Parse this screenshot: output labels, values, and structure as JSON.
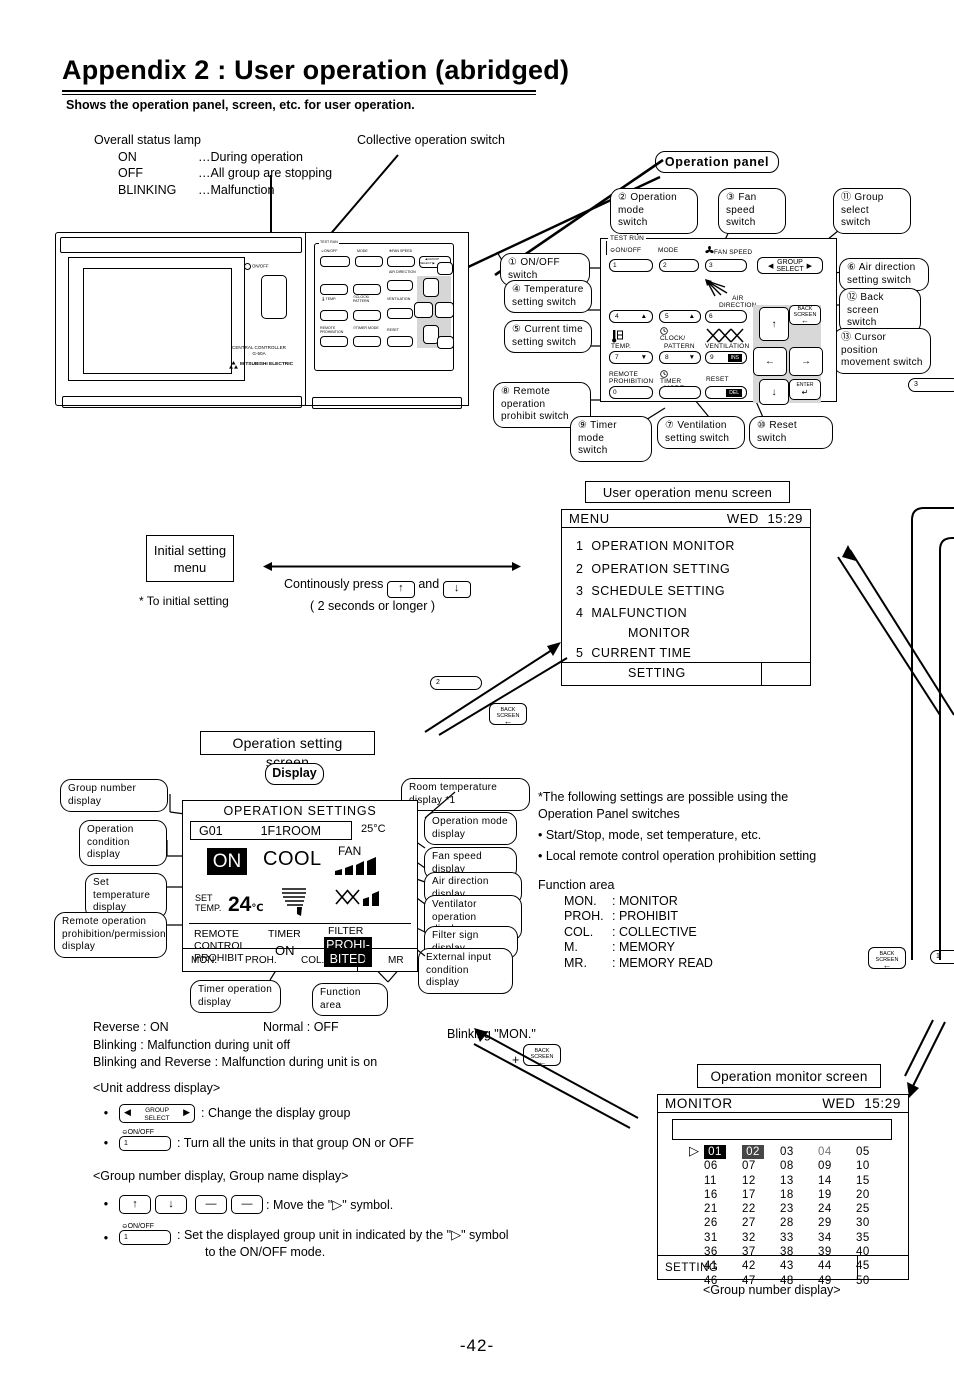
{
  "header": {
    "title": "Appendix 2 : User operation (abridged)",
    "subtitle": "Shows the operation panel, screen, etc. for user operation."
  },
  "status_lamp": {
    "heading": "Overall status lamp",
    "rows": [
      {
        "key": "ON",
        "value": "…During operation"
      },
      {
        "key": "OFF",
        "value": "…All group are stopping"
      },
      {
        "key": "BLINKING",
        "value": "…Malfunction"
      }
    ]
  },
  "collective_switch_label": "Collective operation switch",
  "device": {
    "brand_line1": "CENTRAL  CONTROLLER",
    "brand_line2": "G-50A",
    "logo": "MITSUBISHI ELECTRIC",
    "lamp_label": "ON/OFF"
  },
  "operation_panel": {
    "title": "Operation  panel",
    "callouts": [
      {
        "id": "op-callout-1",
        "text": "① ON/OFF  switch"
      },
      {
        "id": "op-callout-2",
        "text": "② Operation mode\n     switch"
      },
      {
        "id": "op-callout-3",
        "text": "③ Fan  speed\n     switch"
      },
      {
        "id": "op-callout-11",
        "text": "⑪ Group  select\n     switch"
      },
      {
        "id": "op-callout-4",
        "text": "④ Temperature\n     setting switch"
      },
      {
        "id": "op-callout-5",
        "text": "⑤ Current  time\n     setting switch"
      },
      {
        "id": "op-callout-6",
        "text": "⑥ Air  direction\n     setting switch"
      },
      {
        "id": "op-callout-12",
        "text": "⑫ Back  screen\n     switch"
      },
      {
        "id": "op-callout-13",
        "text": "⑬ Cursor  position\n     movement switch"
      },
      {
        "id": "op-callout-8",
        "text": "⑧ Remote operation\n     prohibit switch"
      },
      {
        "id": "op-callout-9",
        "text": "⑨ Timer mode\n     switch"
      },
      {
        "id": "op-callout-7",
        "text": "⑦ Ventilation\n     setting switch"
      },
      {
        "id": "op-callout-10",
        "text": "⑩ Reset  switch"
      }
    ],
    "keys": {
      "test_run": "TEST RUN",
      "on_off": "ON/OFF",
      "mode": "MODE",
      "fan_speed": "FAN SPEED",
      "group_select": "GROUP SELECT",
      "air_direction": "AIR DIRECTION",
      "temp": "TEMP.",
      "clock_pattern": "CLOCK/ PATTERN",
      "ventilation": "VENTILATION",
      "remote_prohibition": "REMOTE PROHIBITION",
      "timer_mode": "TIMER MODE",
      "reset": "RESET",
      "back_screen": "BACK SCREEN",
      "enter": "ENTER",
      "nums": [
        "1",
        "2",
        "3",
        "4",
        "5",
        "6",
        "7",
        "8",
        "9",
        "0"
      ],
      "ins": "INS",
      "del": "DEL"
    }
  },
  "menu_screen": {
    "box_label": "User operation menu screen",
    "title": "MENU",
    "day": "WED",
    "time": "15:29",
    "items": [
      {
        "num": "1",
        "text": "OPERATION  MONITOR",
        "second": ""
      },
      {
        "num": "2",
        "text": "OPERATION  SETTING",
        "second": ""
      },
      {
        "num": "3",
        "text": "SCHEDULE  SETTING",
        "second": ""
      },
      {
        "num": "4",
        "text": "MALFUNCTION",
        "second": "MONITOR"
      },
      {
        "num": "5",
        "text": "CURRENT  TIME",
        "second": "SETTING"
      }
    ]
  },
  "initial_setting": {
    "box_line1": "Initial setting",
    "box_line2": "menu",
    "note": "* To initial setting",
    "press_line1_a": "Continously press",
    "press_line1_and": "and",
    "press_line2": "( 2 seconds or longer )",
    "key_up": "↑",
    "key_down": "↓"
  },
  "operation_setting": {
    "box_label": "Operation setting screen",
    "display_pill": "Display",
    "screen": {
      "title": "OPERATION  SETTINGS",
      "group_no": "G01",
      "group_name": "1F1ROOM",
      "room_temp": "25°C",
      "condition": "ON",
      "mode": "COOL",
      "fan_label": "FAN",
      "set_temp_label1": "SET",
      "set_temp_label2": "TEMP.",
      "set_temp_value": "24",
      "set_temp_unit": "℃",
      "remote_l1": "REMOTE",
      "remote_l2": "CONTROL",
      "remote_l3": "PROHIBIT",
      "timer_label": "TIMER",
      "timer_value": "ON",
      "filter_label": "FILTER",
      "filter_v1": "PROHI-",
      "filter_v2": "BITED",
      "func_items": [
        "MON.",
        "PROH.",
        "COL.",
        "M",
        "MR"
      ]
    },
    "callouts_left": [
      "Group  number  display",
      "Operation\ncondition display",
      "Set  temperature\ndisplay",
      "Remote  operation\nprohibition/permission\ndisplay",
      "Timer  operation\ndisplay",
      "Function  area"
    ],
    "callouts_right": [
      "Room temperature display *1",
      "Operation  mode\ndisplay",
      "Fan  speed  display",
      "Air  direction  display",
      "Ventilator  operation\ndisplay",
      "Filter  sign  display",
      "External  input\ncondition display"
    ]
  },
  "right_notes": {
    "line1": "*The following settings are possible using the",
    "line2": " Operation Panel switches",
    "bullet1": "• Start/Stop, mode, set temperature, etc.",
    "bullet2": "• Local remote control operation prohibition setting",
    "function_area_title": "Function area",
    "function_area": [
      {
        "k": "MON.",
        "v": ": MONITOR"
      },
      {
        "k": "PROH.",
        "v": ": PROHIBIT"
      },
      {
        "k": "COL.",
        "v": ": COLLECTIVE"
      },
      {
        "k": "M.",
        "v": ": MEMORY"
      },
      {
        "k": "MR.",
        "v": ": MEMORY READ"
      }
    ]
  },
  "legend": {
    "reverse": "Reverse : ON",
    "normal": "Normal : OFF",
    "blinking": "Blinking : Malfunction during unit off",
    "blinking_reverse": "Blinking and Reverse : Malfunction during unit is on"
  },
  "instructions": {
    "heading1": "<Unit address display>",
    "item1_key_line1": "GROUP",
    "item1_key_line2": "SELECT",
    "item1_text": ": Change the display group",
    "item2_key": "ON/OFF",
    "item2_num": "1",
    "item2_text": ": Turn all the units in that group ON or OFF",
    "heading2": "<Group number display, Group name display>",
    "item3_keys": [
      "↑",
      "↓",
      "—",
      "—"
    ],
    "item3_text": ": Move the \"  \" symbol.",
    "item4_key": "ON/OFF",
    "item4_num": "1",
    "item4_text": ": Set the displayed group unit in indicated by the \"  \" symbol",
    "item4_text2": "to the ON/OFF mode."
  },
  "blinking_mon": {
    "text": "Blinking \"MON.\"",
    "plus": "+"
  },
  "monitor_screen": {
    "box_label": "Operation monitor screen",
    "title": "MONITOR",
    "day": "WED",
    "time": "15:29",
    "rows": [
      [
        "01",
        "02",
        "03",
        "04",
        "05"
      ],
      [
        "06",
        "07",
        "08",
        "09",
        "10"
      ],
      [
        "11",
        "12",
        "13",
        "14",
        "15"
      ],
      [
        "16",
        "17",
        "18",
        "19",
        "20"
      ],
      [
        "21",
        "22",
        "23",
        "24",
        "25"
      ],
      [
        "26",
        "27",
        "28",
        "29",
        "30"
      ],
      [
        "31",
        "32",
        "33",
        "34",
        "35"
      ],
      [
        "36",
        "37",
        "38",
        "39",
        "40"
      ],
      [
        "41",
        "42",
        "43",
        "44",
        "45"
      ],
      [
        "46",
        "47",
        "48",
        "49",
        "50"
      ]
    ],
    "reverse_cells": [
      "01"
    ],
    "blinking_reverse_cells": [
      "02"
    ],
    "blinking_cells": [
      "04"
    ],
    "caret": "▷",
    "footer": "SETTING",
    "caption": "<Group number display>"
  },
  "back_screen_keys": {
    "line1": "BACK",
    "line2": "SCREEN",
    "arrow": "←"
  },
  "num_callouts": [
    {
      "id": "num-callout-3",
      "value": "3"
    },
    {
      "id": "num-callout-2",
      "value": "2"
    },
    {
      "id": "num-callout-1",
      "value": "1"
    }
  ],
  "page_number": "-42-",
  "colors": {
    "ink": "#000000",
    "paper": "#ffffff",
    "pad_gray": "#d8d8d8"
  }
}
